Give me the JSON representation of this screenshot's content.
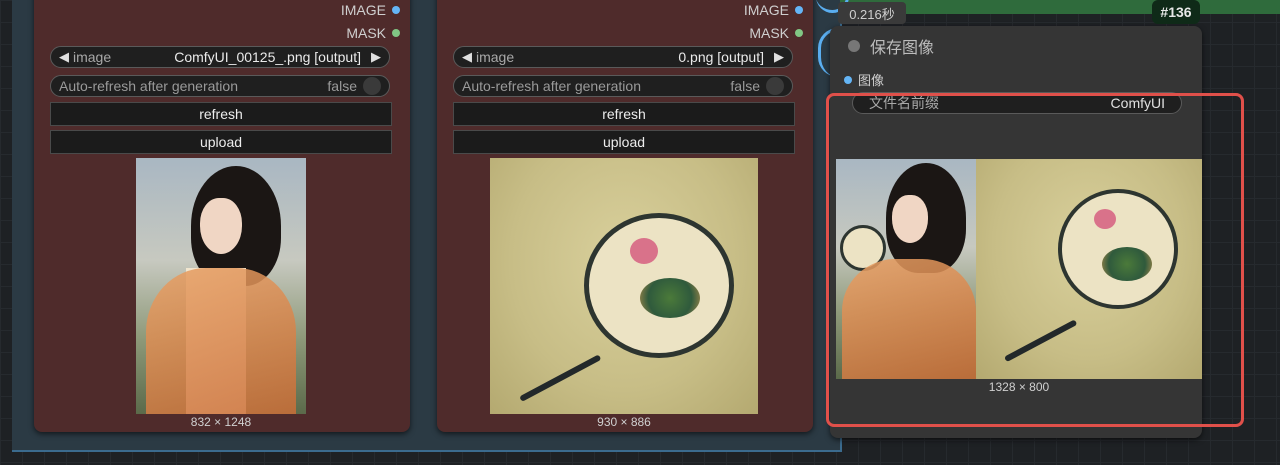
{
  "nodes": [
    {
      "outputs": [
        "IMAGE",
        "MASK"
      ],
      "combo_label": "image",
      "combo_value": "ComfyUI_00125_.png [output]",
      "toggle_label": "Auto-refresh after generation",
      "toggle_value": "false",
      "refresh_label": "refresh",
      "upload_label": "upload",
      "dims": "832 × 1248"
    },
    {
      "outputs": [
        "IMAGE",
        "MASK"
      ],
      "combo_label": "image",
      "combo_value": "0.png [output]",
      "toggle_label": "Auto-refresh after generation",
      "toggle_value": "false",
      "refresh_label": "refresh",
      "upload_label": "upload",
      "dims": "930 × 886"
    }
  ],
  "save_node": {
    "title": "保存图像",
    "input_label": "图像",
    "prefix_label": "文件名前缀",
    "prefix_value": "ComfyUI",
    "dims": "1328 × 800"
  },
  "exec_time": "0.216秒",
  "node_id": "#136",
  "colors": {
    "node_bg": "#4f2b2b",
    "image_port": "#64b5f6",
    "mask_port": "#81c784",
    "highlight": "#e0504a"
  }
}
